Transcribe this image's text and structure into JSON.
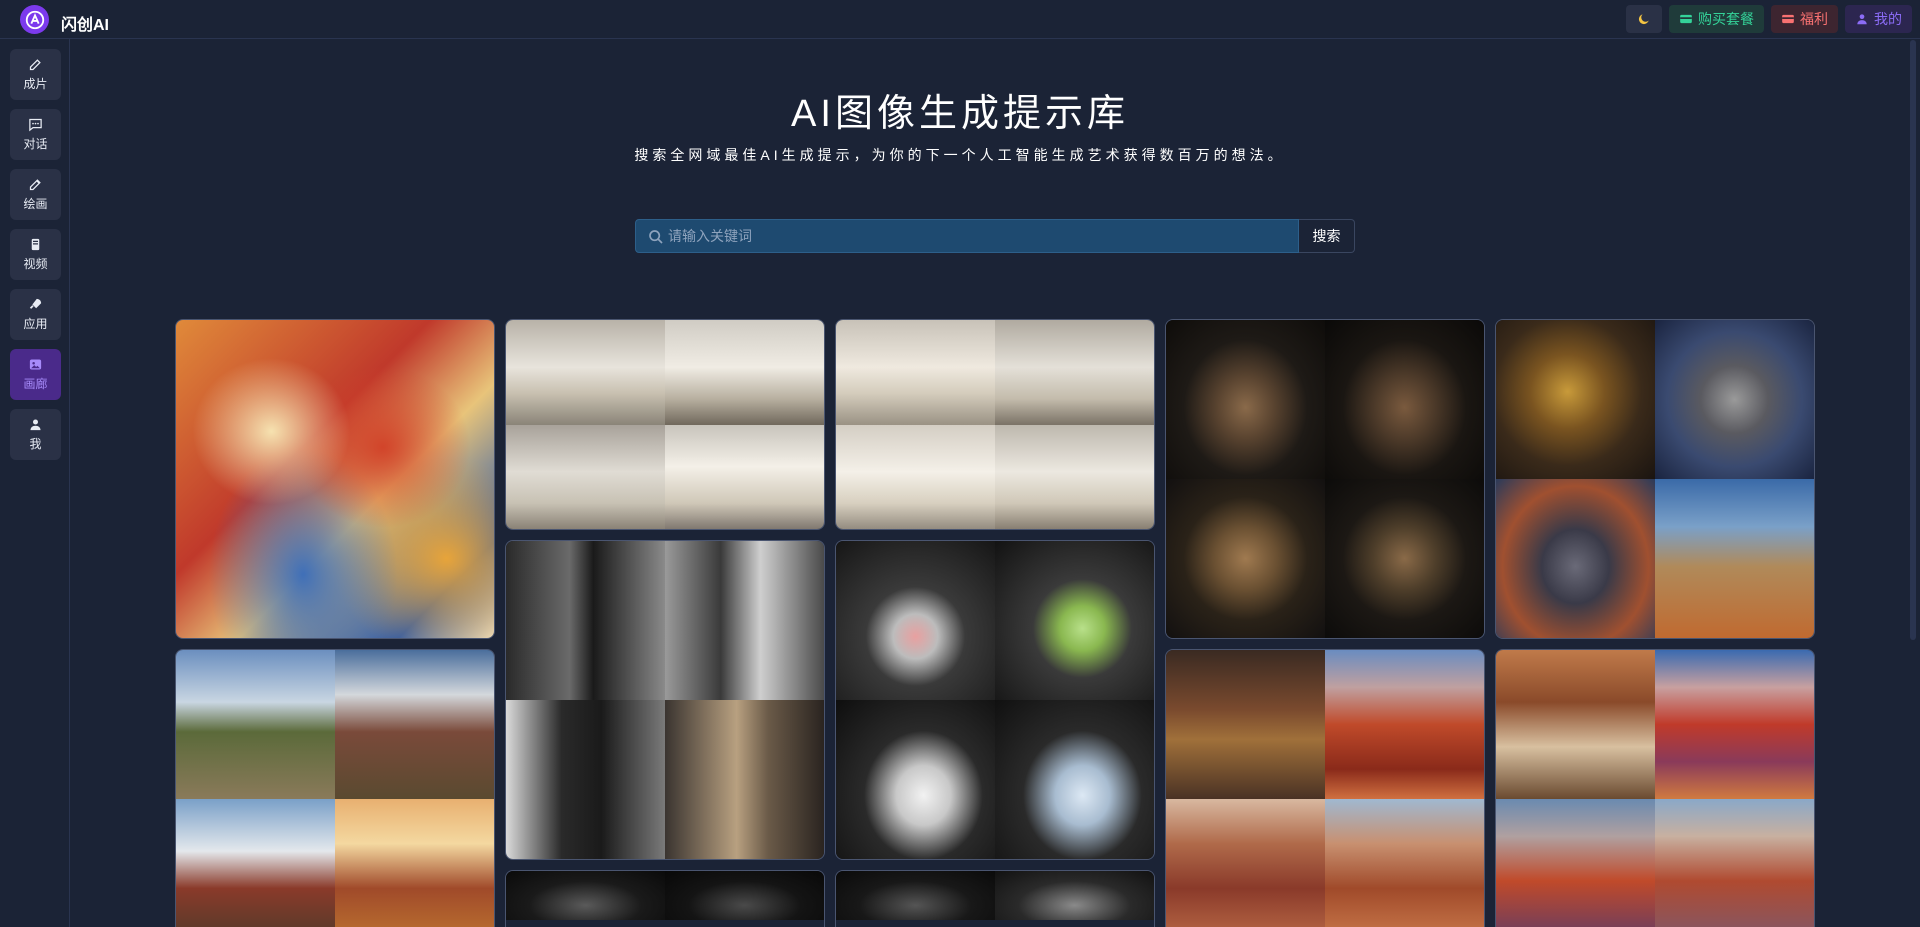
{
  "brand": {
    "name": "闪创AI"
  },
  "header": {
    "buy_label": "购买套餐",
    "gift_label": "福利",
    "me_label": "我的"
  },
  "sidebar": {
    "items": [
      {
        "label": "成片",
        "icon": "edit-icon"
      },
      {
        "label": "对话",
        "icon": "chat-icon"
      },
      {
        "label": "绘画",
        "icon": "brush-icon"
      },
      {
        "label": "视频",
        "icon": "video-icon"
      },
      {
        "label": "应用",
        "icon": "rocket-icon"
      },
      {
        "label": "画廊",
        "icon": "gallery-icon",
        "active": true
      },
      {
        "label": "我",
        "icon": "user-icon"
      }
    ]
  },
  "hero": {
    "title": "AI图像生成提示库",
    "subtitle": "搜索全网域最佳AI生成提示，为你的下一个人工智能生成艺术获得数百万的想法。"
  },
  "search": {
    "placeholder": "请输入关键词",
    "button_label": "搜索"
  },
  "gallery": {
    "items": [
      {
        "name": "gallery-item-silk-dragon",
        "subject": "silk dragon"
      },
      {
        "name": "gallery-item-living-room-1",
        "subject": "living room"
      },
      {
        "name": "gallery-item-living-room-2",
        "subject": "living room"
      },
      {
        "name": "gallery-item-old-man",
        "subject": "portrait"
      },
      {
        "name": "gallery-item-snake",
        "subject": "snake"
      },
      {
        "name": "gallery-item-woman-street",
        "subject": "street fashion"
      },
      {
        "name": "gallery-item-humidifier",
        "subject": "humidifier"
      },
      {
        "name": "gallery-item-potala",
        "subject": "palace"
      },
      {
        "name": "gallery-item-canyon-1",
        "subject": "canyon"
      },
      {
        "name": "gallery-item-canyon-2",
        "subject": "canyon"
      },
      {
        "name": "gallery-item-camera-1",
        "subject": "camera"
      },
      {
        "name": "gallery-item-camera-2",
        "subject": "camera"
      }
    ]
  },
  "colors": {
    "background": "#1b2336",
    "accent": "#7c3aed",
    "buy": "#34d399",
    "gift": "#f87171",
    "me": "#8b6cf6"
  }
}
